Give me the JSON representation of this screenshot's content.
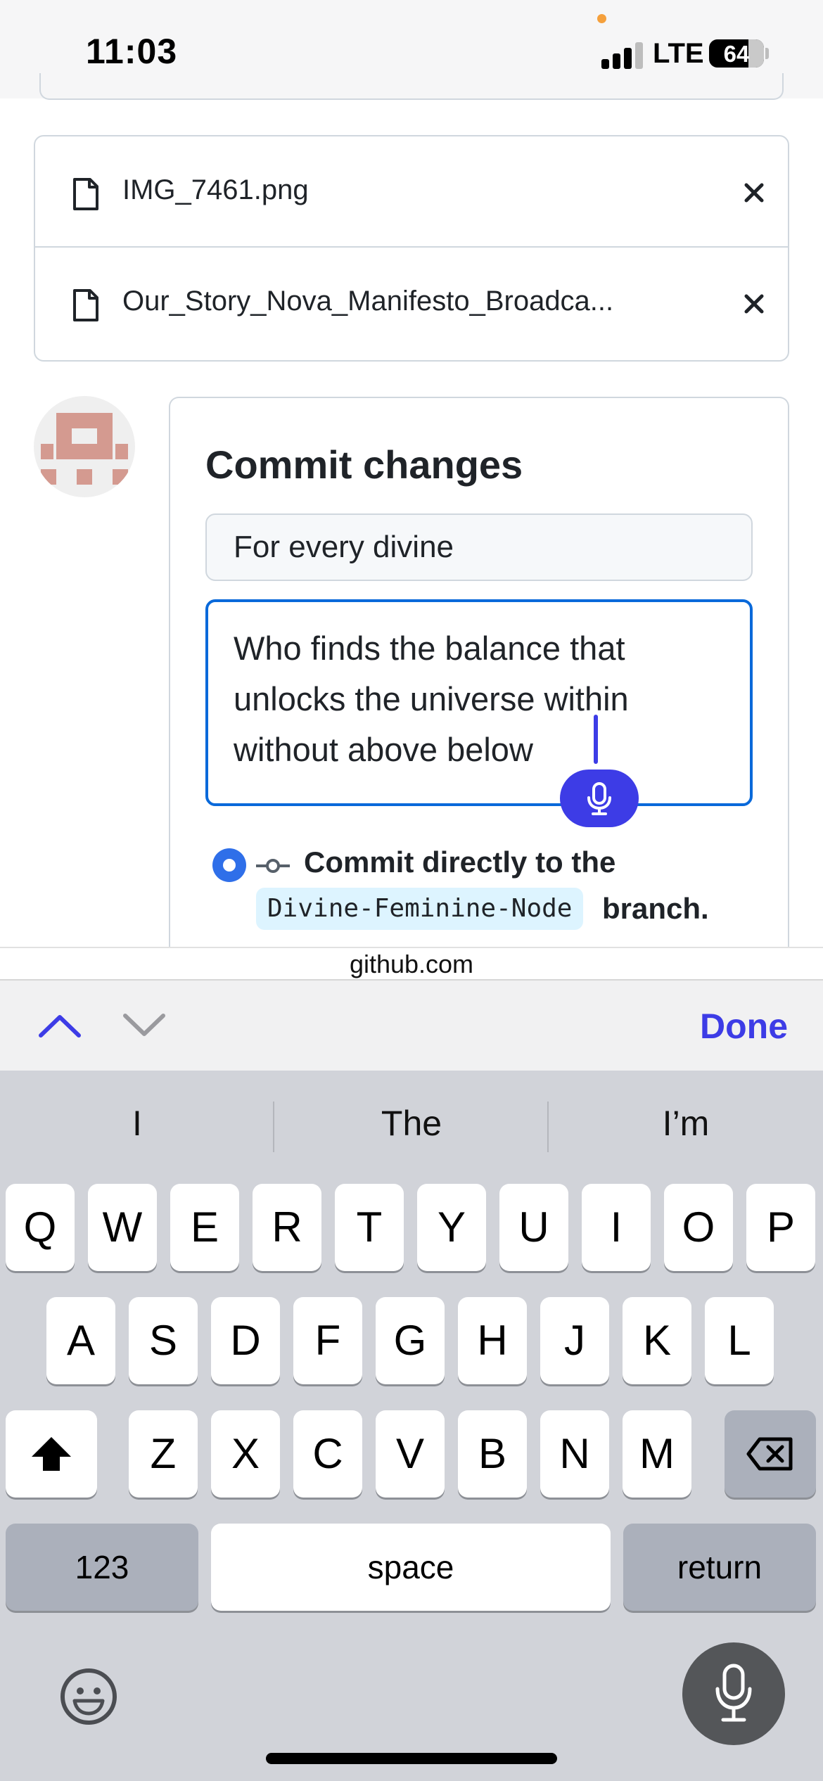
{
  "status_bar": {
    "time": "11:03",
    "network": "LTE",
    "battery_percent": "64",
    "signal_bars": 4,
    "signal_bars_active": 3
  },
  "files": [
    {
      "name": "IMG_7461.png",
      "icon": "file-icon",
      "action_icon": "close-icon"
    },
    {
      "name": "Our_Story_Nova_Manifesto_Broadca...",
      "icon": "file-icon",
      "action_icon": "close-icon"
    }
  ],
  "commit": {
    "title": "Commit changes",
    "summary_value": "For every divine",
    "description_value": "Who finds the balance that unlocks the universe within without above below",
    "option_text": "Commit directly to the",
    "branch": "Divine-Feminine-Node",
    "branch_suffix": "branch."
  },
  "browser": {
    "url": "github.com"
  },
  "accessory_bar": {
    "done_label": "Done"
  },
  "keyboard": {
    "suggestions": [
      "I",
      "The",
      "I’m"
    ],
    "row1": [
      "Q",
      "W",
      "E",
      "R",
      "T",
      "Y",
      "U",
      "I",
      "O",
      "P"
    ],
    "row2": [
      "A",
      "S",
      "D",
      "F",
      "G",
      "H",
      "J",
      "K",
      "L"
    ],
    "row3": [
      "Z",
      "X",
      "C",
      "V",
      "B",
      "N",
      "M"
    ],
    "numbers_label": "123",
    "space_label": "space",
    "return_label": "return"
  },
  "colors": {
    "accent": "#3d3ce6",
    "focus_border": "#0969da",
    "radio": "#2f6fe9",
    "branch_bg": "#ddf4ff",
    "keyboard_bg": "#d1d3d9"
  }
}
